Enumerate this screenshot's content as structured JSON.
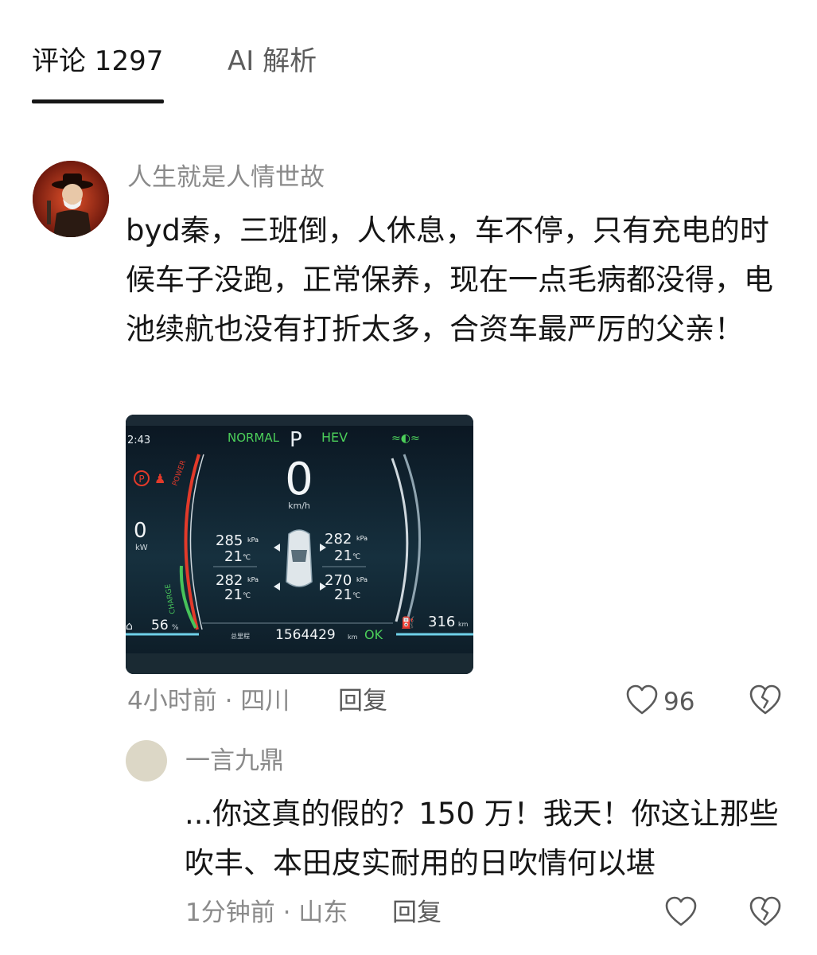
{
  "tabs": [
    {
      "label": "评论 1297"
    },
    {
      "label": "AI 解析"
    }
  ],
  "comment": {
    "author": "人生就是人情世故",
    "text": "byd秦，三班倒，人休息，车不停，只有充电的时候车子没跑，正常保养，现在一点毛病都没得，电池续航也没有打折太多，合资车最严厉的父亲！",
    "meta": "4小时前 · 四川",
    "reply_label": "回复",
    "like_count": "96",
    "photo": {
      "time": "2:43",
      "mode": "NORMAL",
      "gear": "P",
      "hev": "HEV",
      "speed": "0",
      "speed_unit": "km/h",
      "power_value": "0",
      "power_unit": "kW",
      "tires": [
        {
          "pressure": "285",
          "temp": "21"
        },
        {
          "pressure": "282",
          "temp": "21"
        },
        {
          "pressure": "282",
          "temp": "21"
        },
        {
          "pressure": "270",
          "temp": "21"
        }
      ],
      "pressure_unit": "kPa",
      "temp_unit": "℃",
      "battery": "56",
      "battery_unit": "%",
      "range": "316",
      "range_unit": "km",
      "odometer_label": "总里程",
      "odometer": "1564429",
      "odometer_unit": "km",
      "ok": "OK",
      "power_label": "POWER",
      "charge_label": "CHARGE"
    }
  },
  "reply": {
    "author": "一言九鼎",
    "text": "...你这真的假的？150 万！我天！你这让那些吹丰、本田皮实耐用的日吹情何以堪",
    "meta": "1分钟前 · 山东",
    "reply_label": "回复"
  },
  "icons": {
    "like": "heart-outline-icon",
    "dislike": "broken-heart-icon"
  }
}
